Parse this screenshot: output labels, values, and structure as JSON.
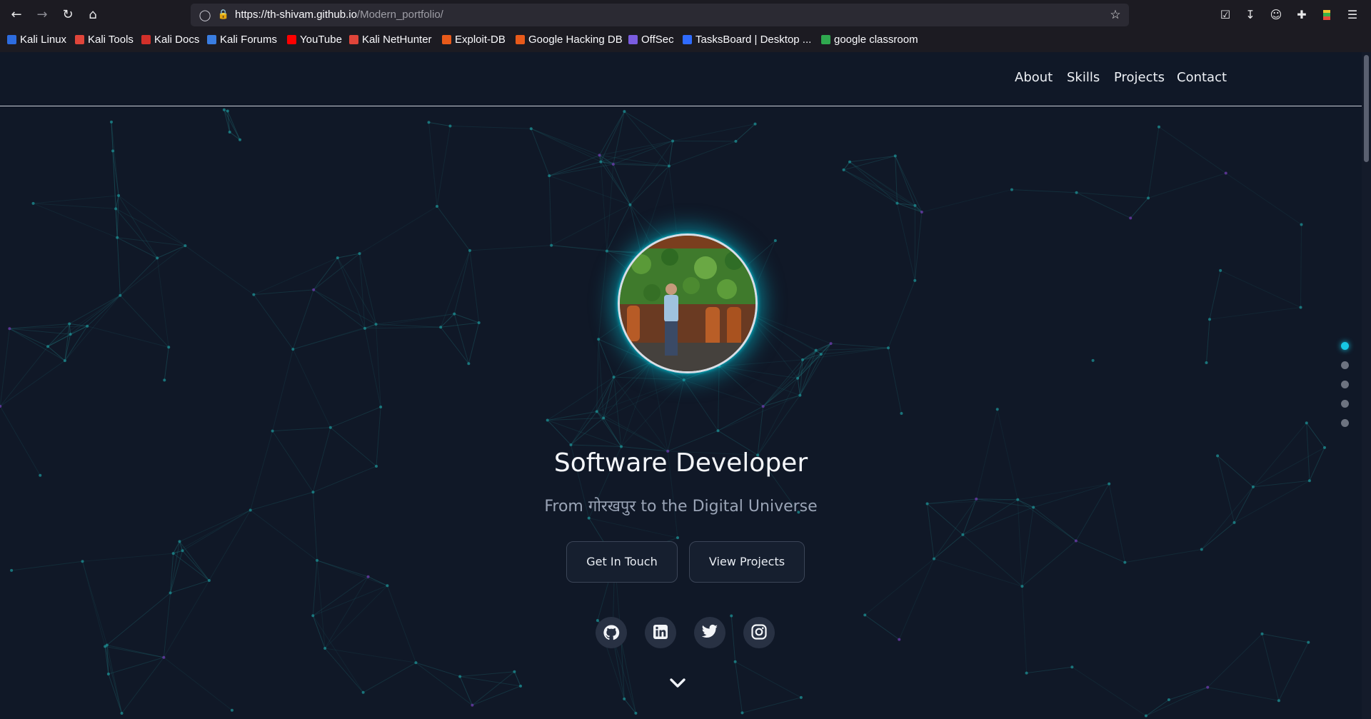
{
  "browser": {
    "url_host": "https://th-shivam.github.io",
    "url_path": "/Modern_portfolio/",
    "bookmarks": [
      {
        "label": "Kali Linux",
        "color": "#2d6cdf"
      },
      {
        "label": "Kali Tools",
        "color": "#e0453a"
      },
      {
        "label": "Kali Docs",
        "color": "#d2302a"
      },
      {
        "label": "Kali Forums",
        "color": "#3a7de0"
      },
      {
        "label": "YouTube",
        "color": "#ff0000"
      },
      {
        "label": "Kali NetHunter",
        "color": "#e0453a"
      },
      {
        "label": "Exploit-DB",
        "color": "#e85a1a"
      },
      {
        "label": "Google Hacking DB",
        "color": "#e85a1a"
      },
      {
        "label": "OffSec",
        "color": "#7a5ce0"
      },
      {
        "label": "TasksBoard | Desktop ...",
        "color": "#2f6bff"
      },
      {
        "label": "google classroom",
        "color": "#2fa84f"
      }
    ]
  },
  "nav": {
    "items": [
      "About",
      "Skills",
      "Projects",
      "Contact"
    ]
  },
  "hero": {
    "title": "Software Developer",
    "subtitle": "From गोरखपुर to the Digital Universe",
    "primary_button": "Get In Touch",
    "secondary_button": "View Projects",
    "socials": [
      "github-icon",
      "linkedin-icon",
      "twitter-icon",
      "instagram-icon"
    ]
  },
  "section_dots": {
    "count": 5,
    "active_index": 0,
    "active_color": "#17c8e4"
  }
}
